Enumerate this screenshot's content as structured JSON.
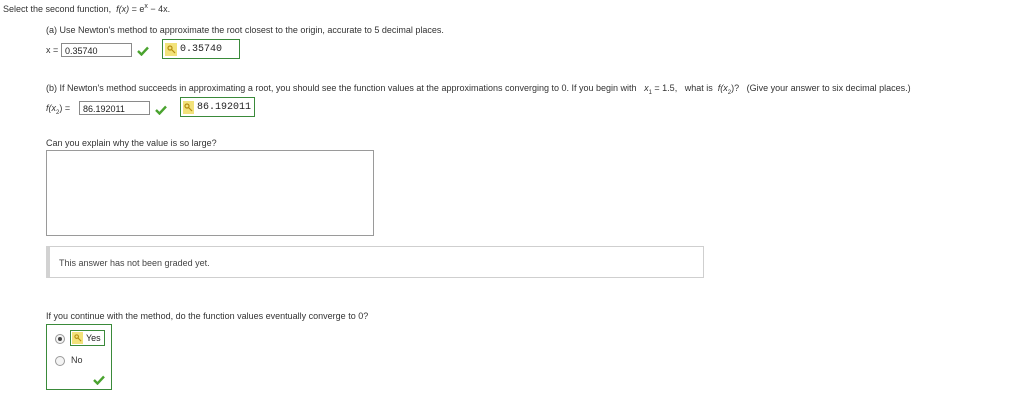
{
  "header": {
    "instruction": "Select the second function,",
    "func_lhs": "f(x)",
    "func_eq": " = e",
    "func_exp": "x",
    "func_rhs": " − 4x."
  },
  "part_a": {
    "question": "(a) Use Newton's method to approximate the root closest to the origin, accurate to 5 decimal places.",
    "var_label": "x =",
    "input_value": "0.35740",
    "answer_key_value": "0.35740"
  },
  "part_b": {
    "question_pre": "(b) If Newton's method succeeds in approximating a root, you should see the function values at the approximations converging to 0. If you begin with",
    "x1_var": "x",
    "x1_sub": "1",
    "x1_val": " = 1.5,",
    "what_is": "what is",
    "fx2_f": "f(x",
    "fx2_sub": "2",
    "fx2_close": ")?",
    "give_answer": "(Give your answer to six decimal places.)",
    "label_f": "f(x",
    "label_sub": "2",
    "label_close": ") =",
    "input_value": "86.192011",
    "answer_key_value": "86.192011"
  },
  "explain": {
    "question": "Can you explain why the value is so large?",
    "textarea_value": ""
  },
  "notice": {
    "text": "This answer has not been graded yet."
  },
  "converge": {
    "question": "If you continue with the method, do the function values eventually converge to 0?",
    "options": [
      {
        "label": "Yes",
        "selected": true,
        "correct": true
      },
      {
        "label": "No",
        "selected": false
      }
    ]
  },
  "colors": {
    "check_green": "#4aa32f",
    "key_border": "#3a8a3a",
    "key_fill": "#f2e27a"
  }
}
